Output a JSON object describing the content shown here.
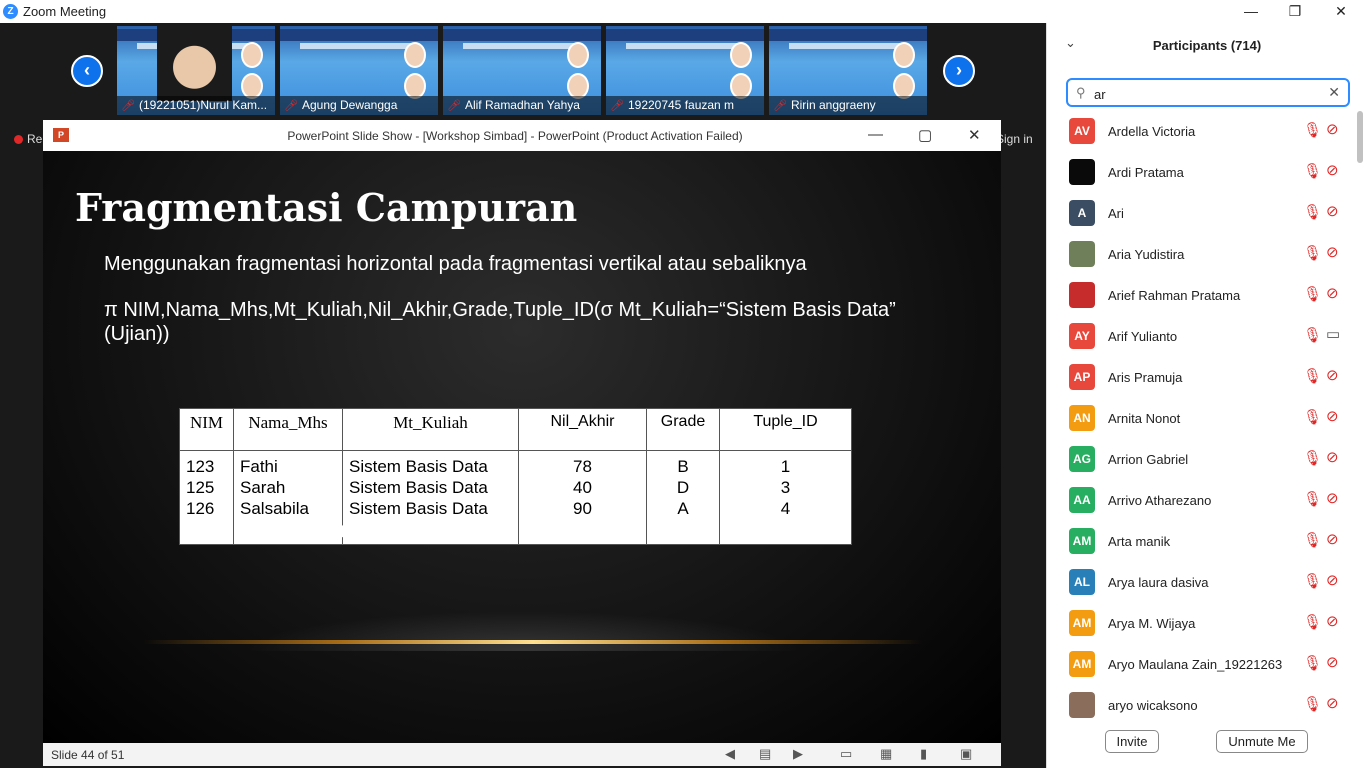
{
  "window": {
    "title": "Zoom Meeting",
    "minimize": "—",
    "maximize": "❐",
    "close": "✕"
  },
  "meeting": {
    "thumbs": [
      {
        "name": "(19221051)Nurul Kam..."
      },
      {
        "name": "Agung Dewangga"
      },
      {
        "name": "Alif Ramadhan Yahya"
      },
      {
        "name": "19220745 fauzan m"
      },
      {
        "name": "Ririn anggraeny"
      }
    ],
    "recording_label": "Re",
    "signin_label": "Sign in",
    "prev_icon": "‹",
    "next_icon": "›"
  },
  "ppt": {
    "title": "PowerPoint Slide Show - [Workshop Simbad] - PowerPoint (Product Activation Failed)",
    "icon_text": "P",
    "status": "Slide 44 of 51"
  },
  "slide": {
    "heading": "Fragmentasi Campuran",
    "subtitle": "Menggunakan fragmentasi horizontal pada fragmentasi vertikal atau sebaliknya",
    "formula_left": "π  NIM,Nama_Mhs,Mt_Kuliah,Nil_Akhir,Grade,Tuple_ID(σ    Mt_Kuliah=“Sistem  Basis  Data”",
    "formula_line2": "(Ujian))",
    "table": {
      "headers": [
        "NIM",
        "Nama_Mhs",
        "Mt_Kuliah",
        "Nil_Akhir",
        "Grade",
        "Tuple_ID"
      ],
      "nim": "123\n125\n126",
      "nama": "Fathi\nSarah\nSalsabila",
      "kuliah": "Sistem Basis Data\nSistem Basis Data\nSistem Basis Data",
      "nilai": "78\n40\n90",
      "grade": "B\nD\nA",
      "tuple": "1\n3\n4"
    }
  },
  "participants": {
    "title": "Participants (714)",
    "search_value": "ar",
    "invite_label": "Invite",
    "unmute_label": "Unmute Me",
    "list": [
      {
        "initials": "AV",
        "name": "Ardella Victoria",
        "color": "#e8483c",
        "camera": "off"
      },
      {
        "initials": "",
        "name": "Ardi Pratama",
        "color": "#0a0a0a",
        "camera": "off"
      },
      {
        "initials": "A",
        "name": "Ari",
        "color": "#3b4d63",
        "camera": "off"
      },
      {
        "initials": "",
        "name": "Aria Yudistira",
        "color": "#6f7f5a",
        "camera": "off"
      },
      {
        "initials": "",
        "name": "Arief Rahman Pratama",
        "color": "#c72c2c",
        "camera": "off"
      },
      {
        "initials": "AY",
        "name": "Arif Yulianto",
        "color": "#e8483c",
        "camera": "on"
      },
      {
        "initials": "AP",
        "name": "Aris Pramuja",
        "color": "#e8483c",
        "camera": "off"
      },
      {
        "initials": "AN",
        "name": "Arnita Nonot",
        "color": "#f39c12",
        "camera": "off"
      },
      {
        "initials": "AG",
        "name": "Arrion Gabriel",
        "color": "#27ae60",
        "camera": "off"
      },
      {
        "initials": "AA",
        "name": "Arrivo Atharezano",
        "color": "#27ae60",
        "camera": "off"
      },
      {
        "initials": "AM",
        "name": "Arta manik",
        "color": "#27ae60",
        "camera": "off"
      },
      {
        "initials": "AL",
        "name": "Arya laura dasiva",
        "color": "#2980b9",
        "camera": "off"
      },
      {
        "initials": "AM",
        "name": "Arya M. Wijaya",
        "color": "#f39c12",
        "camera": "off"
      },
      {
        "initials": "AM",
        "name": "Aryo Maulana Zain_19221263",
        "color": "#f39c12",
        "camera": "off"
      },
      {
        "initials": "",
        "name": "aryo wicaksono",
        "color": "#8a6d5a",
        "camera": "off"
      }
    ]
  }
}
